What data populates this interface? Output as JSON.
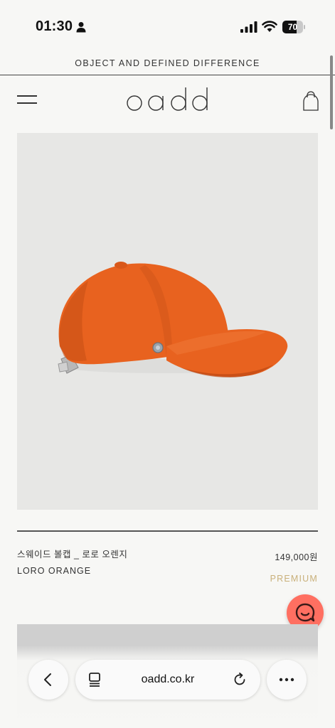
{
  "status_bar": {
    "time": "01:30",
    "battery_level": 70,
    "battery_text": "70"
  },
  "banner": {
    "text": "OBJECT AND DEFINED DIFFERENCE"
  },
  "header": {
    "logo_text": "oadd"
  },
  "product": {
    "name": "스웨이드 볼캡 _ 로로 오렌지",
    "name_en": "LORO ORANGE",
    "price": "149,000원",
    "tag": "PREMIUM",
    "image_color": "#e8621f"
  },
  "browser": {
    "url": "oadd.co.kr"
  },
  "colors": {
    "background": "#f7f7f5",
    "accent_gold": "#c9b07a",
    "chat_button": "#ff6f61"
  },
  "icons": [
    "person-icon",
    "signal-icon",
    "wifi-icon",
    "battery-icon",
    "menu-icon",
    "shopping-bag-icon",
    "chat-icon",
    "back-icon",
    "tabs-icon",
    "reload-icon",
    "more-icon"
  ]
}
